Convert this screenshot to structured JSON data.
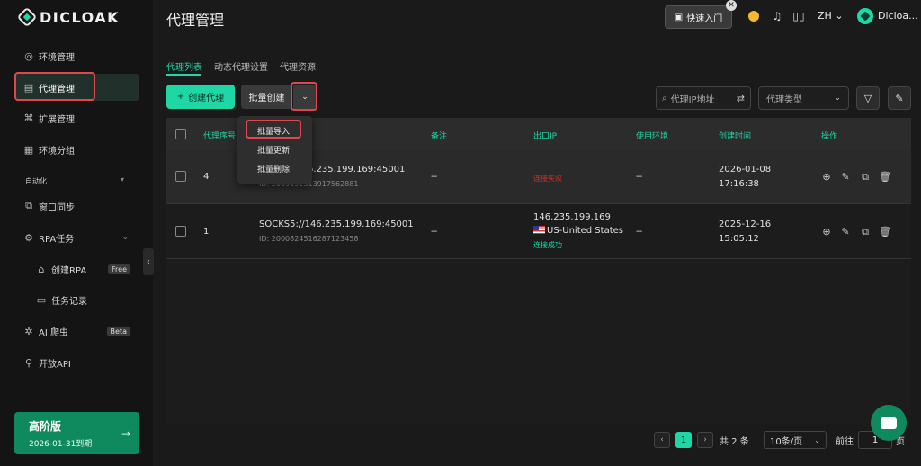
{
  "brand": {
    "name": "DICLOAK",
    "accent": "#1ed7a5",
    "highlight": "#e0484b"
  },
  "sidebar": {
    "items": [
      {
        "label": "环境管理",
        "icon": "globe-icon"
      },
      {
        "label": "代理管理",
        "icon": "proxy-icon"
      },
      {
        "label": "扩展管理",
        "icon": "extension-icon"
      },
      {
        "label": "环境分组",
        "icon": "group-icon"
      }
    ],
    "automation_title": "自动化",
    "automation_items": [
      {
        "label": "窗口同步",
        "icon": "sync-icon"
      },
      {
        "label": "RPA任务",
        "icon": "robot-icon"
      },
      {
        "label": "创建RPA",
        "icon": "store-icon",
        "badge": "Free"
      },
      {
        "label": "任务记录",
        "icon": "document-icon"
      },
      {
        "label": "AI 爬虫",
        "icon": "spider-icon",
        "badge": "Beta"
      },
      {
        "label": "开放API",
        "icon": "api-icon"
      }
    ],
    "premium": {
      "title": "高阶版",
      "expires": "2026-01-31到期"
    }
  },
  "header": {
    "title": "代理管理",
    "quick_start": "快速入门",
    "lang": "ZH",
    "user": "Dicloa..."
  },
  "tabs": [
    "代理列表",
    "动态代理设置",
    "代理资源"
  ],
  "toolbar": {
    "create_label": "创建代理",
    "batch_label": "批量创建",
    "search_placeholder": "代理IP地址",
    "type_placeholder": "代理类型"
  },
  "dropdown": [
    "批量导入",
    "批量更新",
    "批量删除"
  ],
  "table": {
    "columns": [
      "代理序号",
      "备注",
      "出口IP",
      "使用环境",
      "创建时间",
      "操作"
    ],
    "rows": [
      {
        "seq": "4",
        "proxy": "SOCKS5://146.235.199.169:45001",
        "proxy_visible": "6.235.199.169:45001",
        "id": "ID: 2009192513917562881",
        "note": "--",
        "exit_ip": "",
        "country": "",
        "status": "连接失败",
        "env": "--",
        "created_date": "2026-01-08",
        "created_time": "17:16:38"
      },
      {
        "seq": "1",
        "proxy": "SOCKS5://146.235.199.169:45001",
        "id": "ID: 2000824516287123458",
        "note": "--",
        "exit_ip": "146.235.199.169",
        "country": "US-United States",
        "status": "连接成功",
        "env": "--",
        "created_date": "2025-12-16",
        "created_time": "15:05:12"
      }
    ]
  },
  "pagination": {
    "current": "1",
    "total": "共 2 条",
    "page_size": "10条/页",
    "goto_label": "前往",
    "goto_value": "1",
    "page_suffix": "页"
  }
}
